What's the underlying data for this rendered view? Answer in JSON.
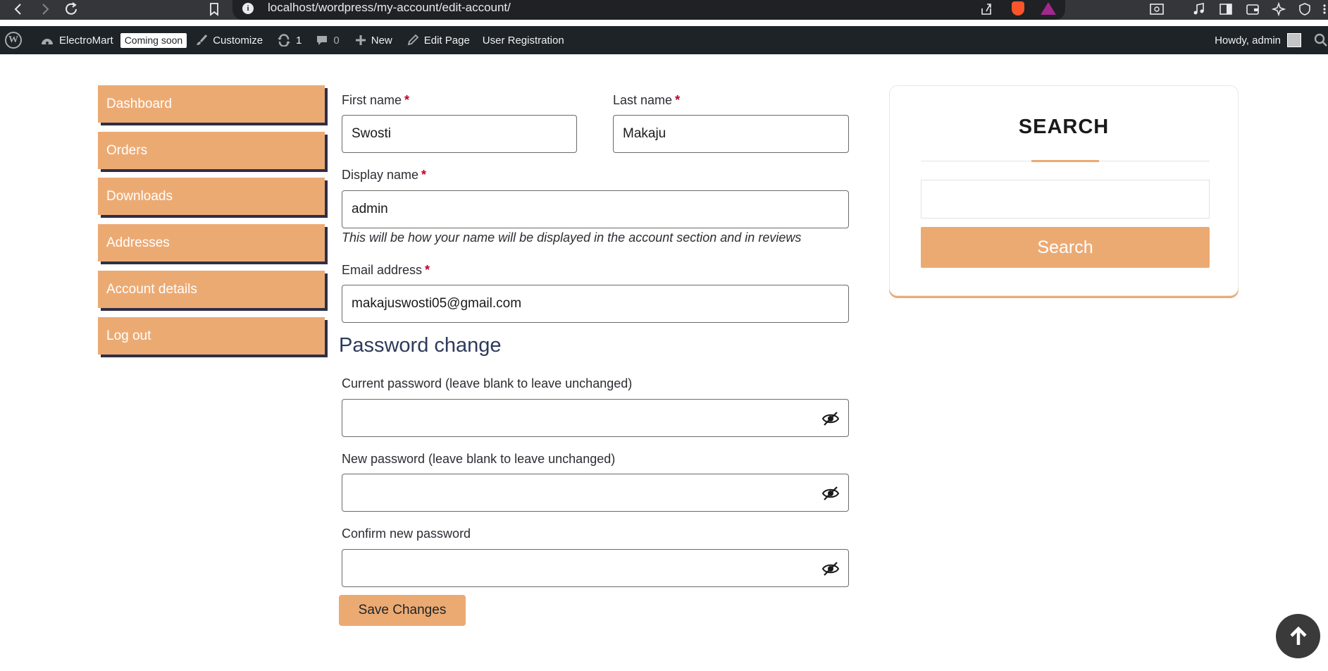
{
  "browser": {
    "url": "localhost/wordpress/my-account/edit-account/",
    "info_glyph": "i"
  },
  "admin_bar": {
    "wp_logo": "W",
    "site_name": "ElectroMart",
    "badge": "Coming soon",
    "customize": "Customize",
    "updates_count": "1",
    "comments_count": "0",
    "new": "New",
    "edit_page": "Edit Page",
    "user_registration": "User Registration",
    "greeting": "Howdy, admin"
  },
  "nav": {
    "items": [
      {
        "label": "Dashboard"
      },
      {
        "label": "Orders"
      },
      {
        "label": "Downloads"
      },
      {
        "label": "Addresses"
      },
      {
        "label": "Account details"
      },
      {
        "label": "Log out"
      }
    ]
  },
  "form": {
    "first_name": {
      "label": "First name",
      "value": "Swosti"
    },
    "last_name": {
      "label": "Last name",
      "value": "Makaju"
    },
    "display_name": {
      "label": "Display name",
      "value": "admin",
      "hint": "This will be how your name will be displayed in the account section and in reviews"
    },
    "email": {
      "label": "Email address",
      "value": "makajuswosti05@gmail.com"
    },
    "required_mark": "*",
    "password_section_title": "Password change",
    "current_password": {
      "label": "Current password (leave blank to leave unchanged)",
      "value": ""
    },
    "new_password": {
      "label": "New password (leave blank to leave unchanged)",
      "value": ""
    },
    "confirm_password": {
      "label": "Confirm new password",
      "value": ""
    },
    "save_label": "Save Changes"
  },
  "search_widget": {
    "title": "SEARCH",
    "input_value": "",
    "button_label": "Search"
  },
  "colors": {
    "accent": "#ecaa73",
    "admin_bar": "#1d2327",
    "nav_shadow": "#2e2f48",
    "required": "#c0002a"
  },
  "icons": [
    "back-icon",
    "forward-icon",
    "reload-icon",
    "bookmark-icon",
    "share-icon",
    "brave-shield-icon",
    "brave-rewards-icon",
    "eye-slash-icon",
    "arrow-up-icon"
  ]
}
